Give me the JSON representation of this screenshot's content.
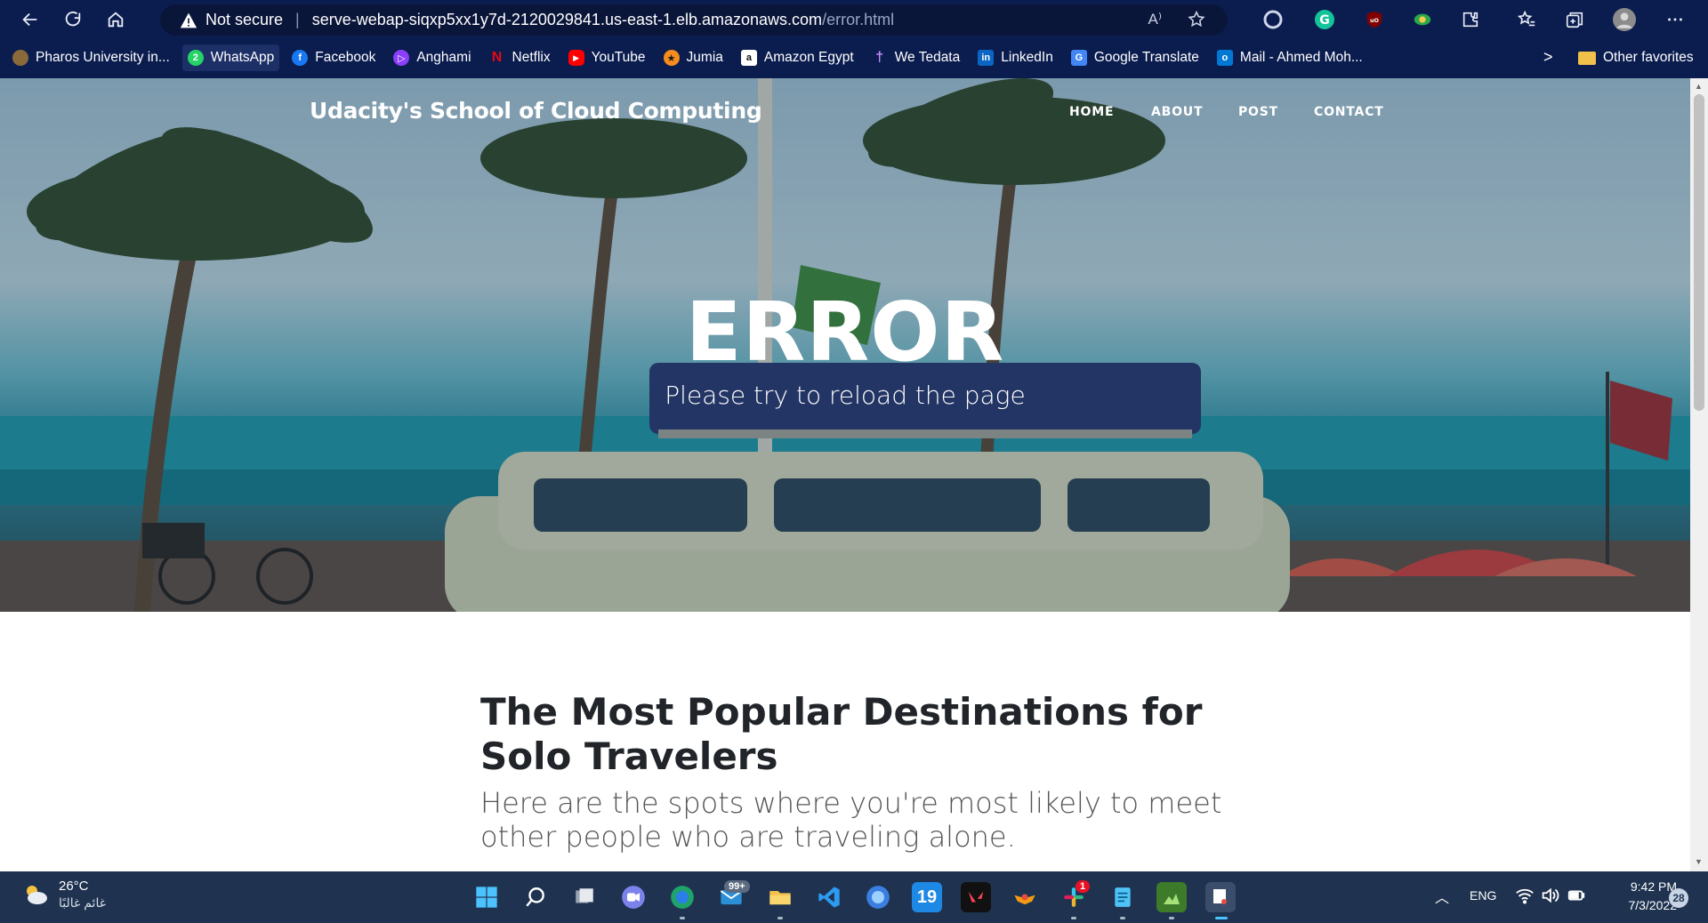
{
  "browser": {
    "security_label": "Not secure",
    "url_host": "serve-webap-siqxp5xx1y7d-2120029841.us-east-1.elb.amazonaws.com",
    "url_path": "/error.html",
    "read_aloud_icon": "A⁾",
    "bookmarks": [
      {
        "label": "Pharos University in...",
        "icon_color": "#8a6a3a",
        "icon_text": ""
      },
      {
        "label": "WhatsApp",
        "icon_color": "#25d366",
        "icon_text": "2"
      },
      {
        "label": "Facebook",
        "icon_color": "#1877f2",
        "icon_text": "f"
      },
      {
        "label": "Anghami",
        "icon_color": "#8a3ffc",
        "icon_text": "▷"
      },
      {
        "label": "Netflix",
        "icon_color": "#e50914",
        "icon_text": "N"
      },
      {
        "label": "YouTube",
        "icon_color": "#ff0000",
        "icon_text": "▶"
      },
      {
        "label": "Jumia",
        "icon_color": "#f68b1e",
        "icon_text": "★"
      },
      {
        "label": "Amazon Egypt",
        "icon_color": "#ffffff",
        "icon_text": "a"
      },
      {
        "label": "We Tedata",
        "icon_color": "#5c2d91",
        "icon_text": "†"
      },
      {
        "label": "LinkedIn",
        "icon_color": "#0a66c2",
        "icon_text": "in"
      },
      {
        "label": "Google Translate",
        "icon_color": "#4285f4",
        "icon_text": "G"
      },
      {
        "label": "Mail - Ahmed Moh...",
        "icon_color": "#0078d4",
        "icon_text": "o"
      }
    ],
    "bookmarks_more": ">",
    "other_favorites": "Other favorites"
  },
  "site": {
    "brand": "Udacity's School of Cloud Computing",
    "nav": [
      "HOME",
      "ABOUT",
      "POST",
      "CONTACT"
    ],
    "hero_title": "ERROR",
    "hero_subtitle": "Please try to reload the page",
    "post_title": "The Most Popular Destinations for Solo Travelers",
    "post_subtitle": "Here are the spots where you're most likely to meet other people who are traveling alone."
  },
  "taskbar": {
    "temperature": "26°C",
    "weather_desc": "غائم غالبًا",
    "mail_badge": "99+",
    "slack_badge": "1",
    "calendar_day": "19",
    "language": "ENG",
    "time": "9:42 PM",
    "date": "7/3/2022",
    "notifications": "28"
  },
  "colors": {
    "chrome_bg": "#0b1d4f",
    "taskbar_bg": "#1f3350",
    "heading_text": "#212529"
  }
}
